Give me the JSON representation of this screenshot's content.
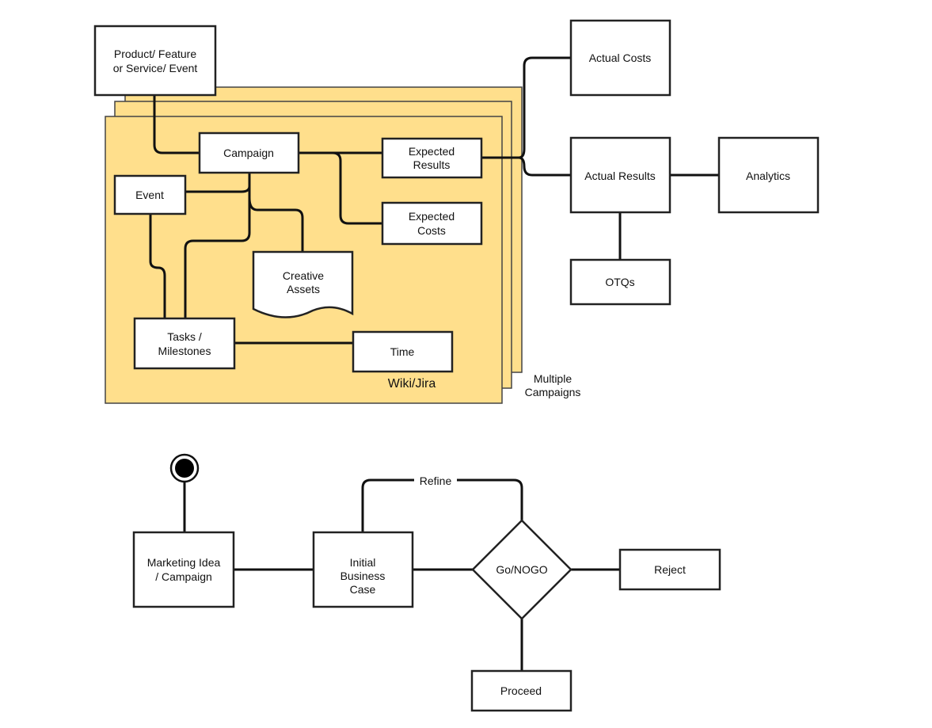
{
  "colors": {
    "sheet_fill": "#FFDF8C",
    "line": "#111111",
    "box_fill": "#FFFFFF"
  },
  "top_diagram": {
    "product": [
      "Product/ Feature",
      "or Service/ Event"
    ],
    "campaign": "Campaign",
    "event": "Event",
    "expected_results": [
      "Expected",
      "Results"
    ],
    "expected_costs": [
      "Expected",
      "Costs"
    ],
    "creative_assets": [
      "Creative",
      "Assets"
    ],
    "tasks": [
      "Tasks /",
      "Milestones"
    ],
    "time": "Time",
    "container_label": "Wiki/Jira",
    "stack_label": [
      "Multiple",
      "Campaigns"
    ],
    "actual_costs": "Actual Costs",
    "actual_results": "Actual Results",
    "analytics": "Analytics",
    "otqs": "OTQs"
  },
  "bottom_diagram": {
    "marketing_idea": [
      "Marketing Idea",
      "/ Campaign"
    ],
    "initial_business_case": [
      "Initial",
      "Business",
      "Case"
    ],
    "decision": "Go/NOGO",
    "refine_label": "Refine",
    "reject": "Reject",
    "proceed": "Proceed"
  }
}
